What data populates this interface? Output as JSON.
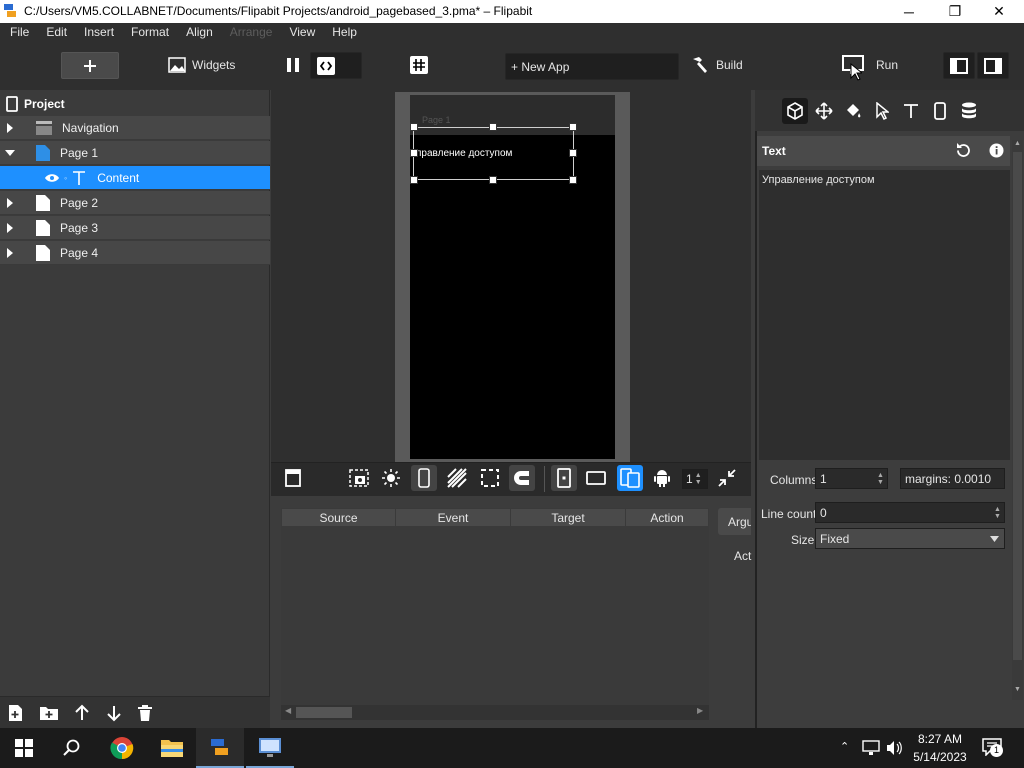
{
  "window": {
    "title": "C:/Users/VM5.COLLABNET/Documents/Flipabit Projects/android_pagebased_3.pma* – Flipabit",
    "minimize": "─",
    "maximize": "❐",
    "close": "✕"
  },
  "menu": [
    "File",
    "Edit",
    "Insert",
    "Format",
    "Align",
    "Arrange",
    "View",
    "Help"
  ],
  "toolbar": {
    "widgets_label": "Widgets",
    "new_app_label": "+ New App",
    "build_label": "Build",
    "run_label": "Run"
  },
  "project": {
    "title": "Project",
    "items": [
      {
        "label": "Navigation"
      },
      {
        "label": "Page 1"
      },
      {
        "label": "Content"
      },
      {
        "label": "Page 2"
      },
      {
        "label": "Page 3"
      },
      {
        "label": "Page 4"
      }
    ]
  },
  "canvas": {
    "page_label": "Page 1",
    "text_widget": "правление доступом",
    "zoom_value": "1"
  },
  "events": {
    "columns": [
      "Source",
      "Event",
      "Target",
      "Action"
    ],
    "args_tab": "Argu",
    "action_label": "Act"
  },
  "properties": {
    "section_title": "Text",
    "text_value": "Управление доступом",
    "columns_label": "Columns",
    "columns_value": "1",
    "margins_value": "margins: 0.0010",
    "line_count_label": "Line count",
    "line_count_value": "0",
    "size_label": "Size",
    "size_value": "Fixed"
  },
  "taskbar": {
    "time": "8:27 AM",
    "date": "5/14/2023",
    "notification_count": "1"
  },
  "colors": {
    "accent": "#1e90ff",
    "panel": "#3b3b3b",
    "toolbar": "#2f2f2f"
  }
}
